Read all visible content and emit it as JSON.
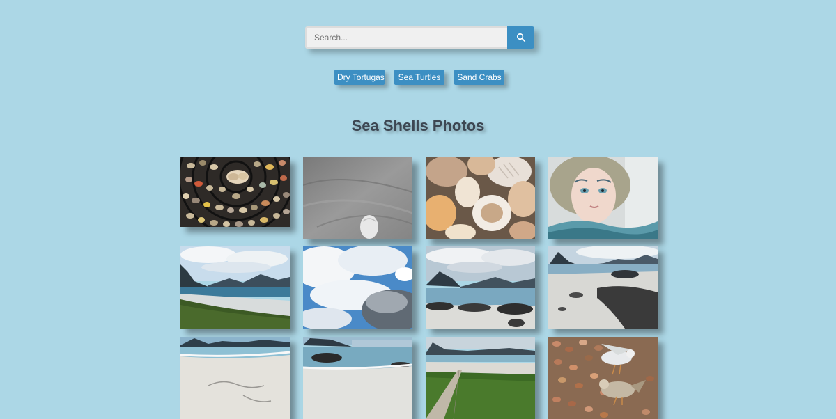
{
  "search": {
    "placeholder": "Search...",
    "icon": "search-icon"
  },
  "tags": [
    {
      "label": "Dry Tortugas"
    },
    {
      "label": "Sea Turtles"
    },
    {
      "label": "Sand Crabs"
    }
  ],
  "page": {
    "title": "Sea Shells Photos"
  },
  "gallery": {
    "photos": [
      {
        "subject": "shell mosaic"
      },
      {
        "subject": "shell on sand"
      },
      {
        "subject": "pile of shells"
      },
      {
        "subject": "mermaid portrait"
      },
      {
        "subject": "coastal beach with grass"
      },
      {
        "subject": "clouds and blue sky"
      },
      {
        "subject": "rocky beach with mountains"
      },
      {
        "subject": "beach with rocks"
      },
      {
        "subject": "sandy beach shoreline"
      },
      {
        "subject": "beach with rock in water"
      },
      {
        "subject": "boardwalk path to beach"
      },
      {
        "subject": "bird on shells"
      }
    ]
  },
  "colors": {
    "background": "#acd7e6",
    "accent": "#3c8fc3",
    "title": "#3d4753"
  }
}
